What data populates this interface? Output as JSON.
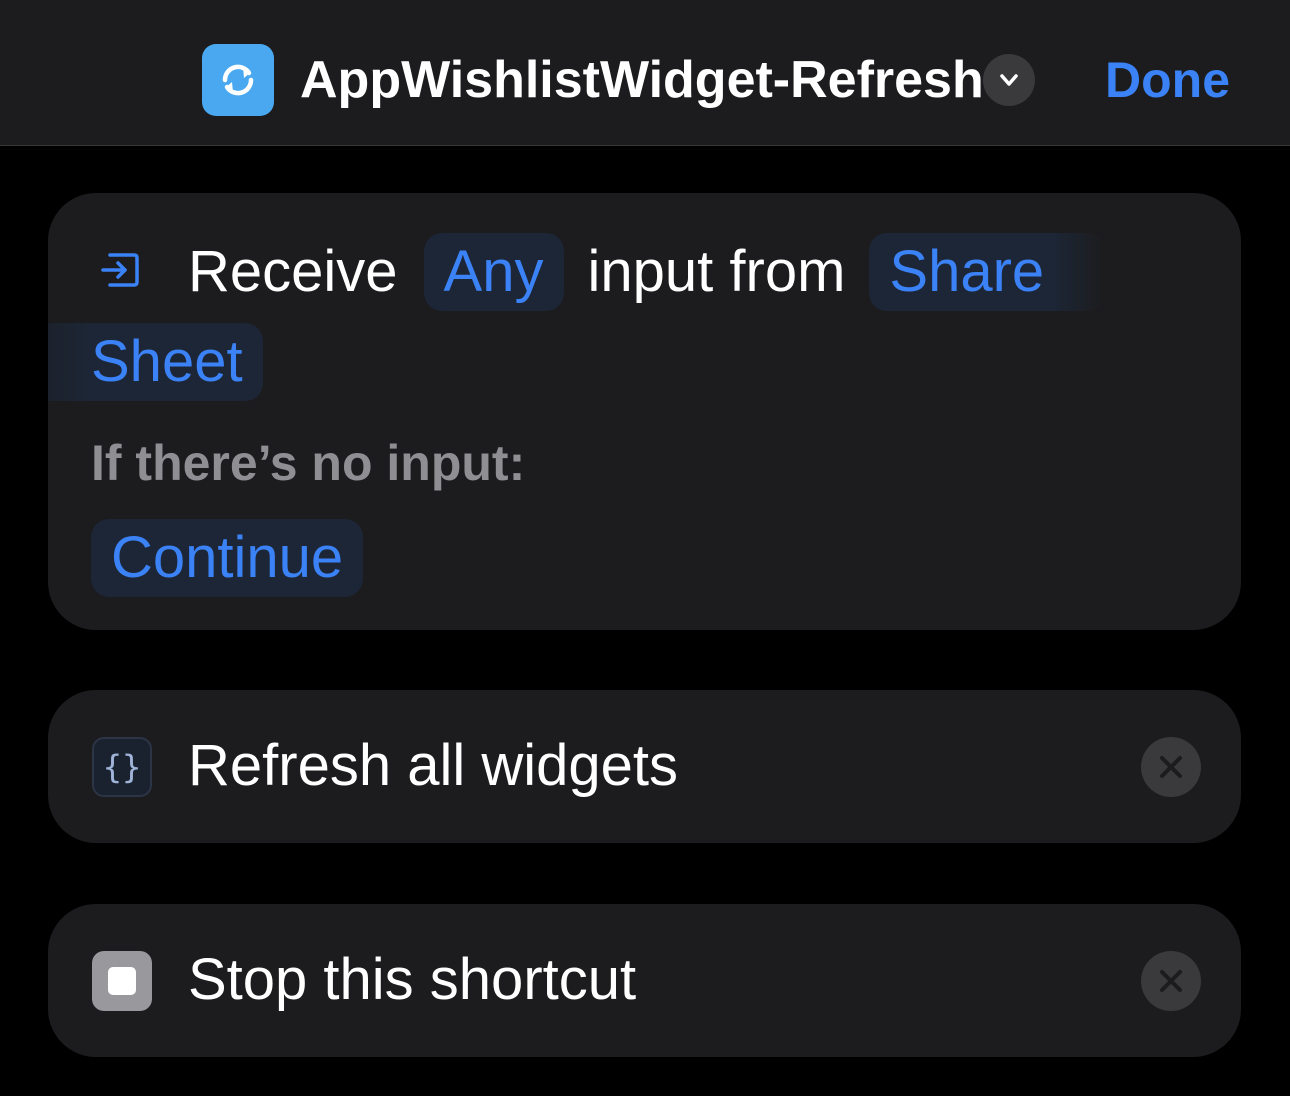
{
  "header": {
    "title": "AppWishlistWidget-Refresh",
    "done_label": "Done",
    "app_icon": "refresh-arrows-icon",
    "accent_color": "#3b82f6"
  },
  "actions": [
    {
      "type": "receive-input",
      "icon": "input-arrow-icon",
      "word_receive": "Receive",
      "token_type": "Any",
      "word_input_from": "input from",
      "token_source_1": "Share",
      "token_source_2": "Sheet",
      "no_input_label": "If there’s no input:",
      "no_input_option": "Continue"
    },
    {
      "type": "refresh-widgets",
      "icon": "script-braces-icon",
      "icon_text": "{}",
      "label": "Refresh all widgets"
    },
    {
      "type": "stop-shortcut",
      "icon": "stop-square-icon",
      "label": "Stop this shortcut"
    }
  ]
}
